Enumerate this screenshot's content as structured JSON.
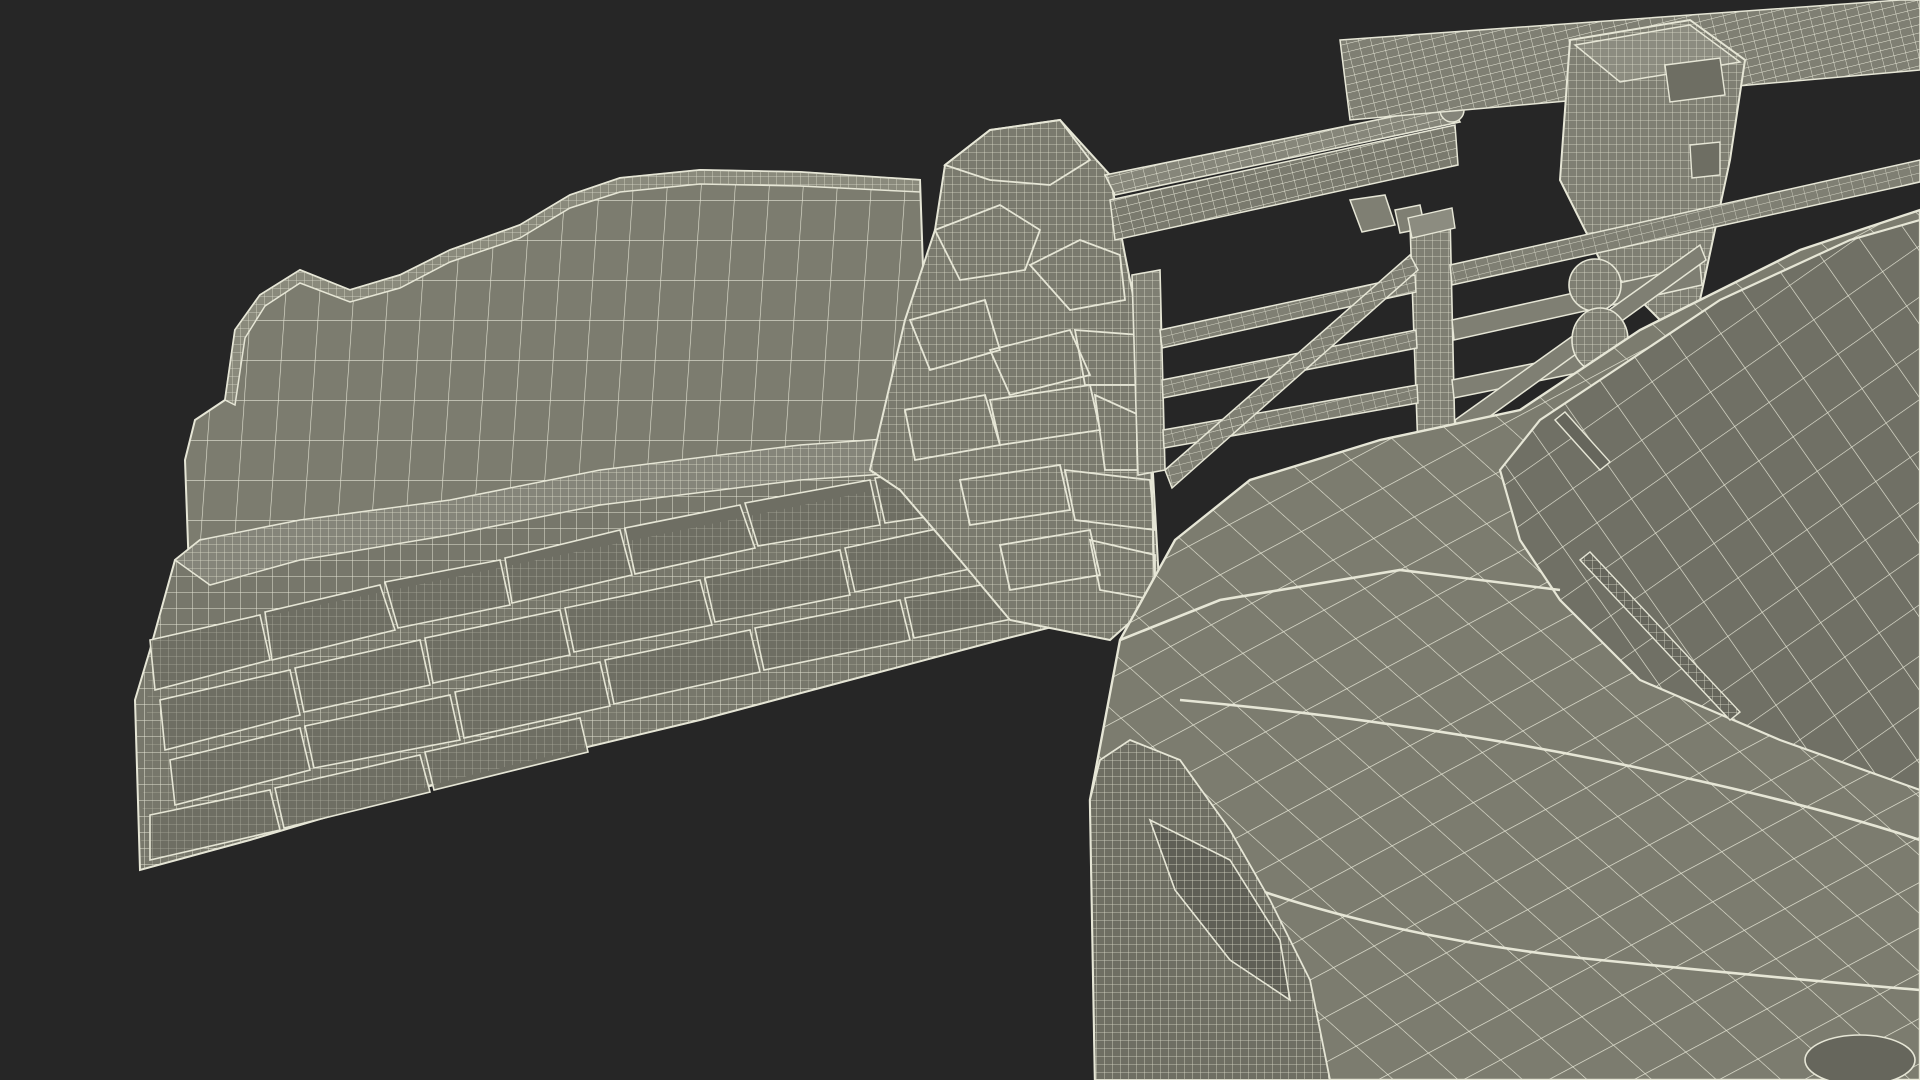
{
  "scene": {
    "background": "#262626",
    "surface_fill": "#7c7c6f",
    "surface_fill_dark": "#6a6a5f",
    "surface_fill_light": "#8a8a7c",
    "wire_color": "#e6e6d6",
    "wire_color_dense": "#d8d8c6",
    "objects": [
      {
        "name": "stone-wall-with-slab"
      },
      {
        "name": "stone-pillar"
      },
      {
        "name": "wooden-farm-gate"
      },
      {
        "name": "wooden-handrail"
      },
      {
        "name": "gate-post-right"
      },
      {
        "name": "car-hood"
      }
    ]
  }
}
